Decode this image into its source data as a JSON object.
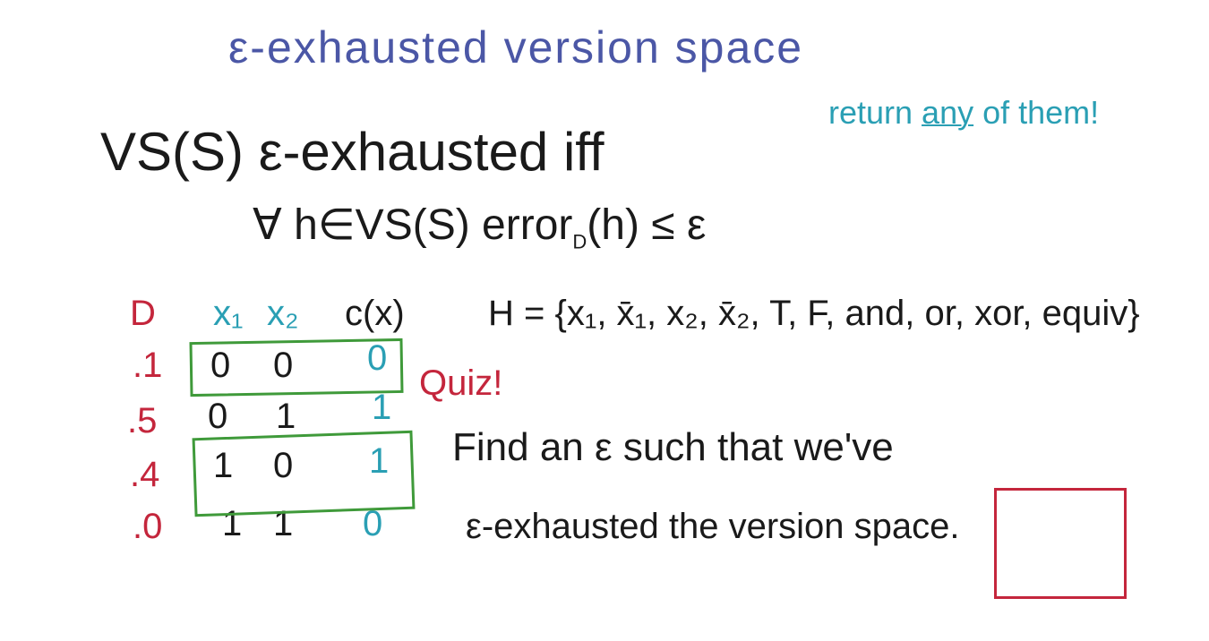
{
  "title": "ε-exhausted version space",
  "aside": {
    "prefix": "return ",
    "emph": "any",
    "suffix": " of them!"
  },
  "definition": "VS(S) ε-exhausted iff",
  "condition": {
    "pre": "∀ h∈VS(S)   error",
    "sub": "D",
    "post": "(h) ≤ ε"
  },
  "table": {
    "headers": {
      "d": "D",
      "x1": "x₁",
      "x2": "x₂",
      "c": "c(x)"
    },
    "rows": [
      {
        "d": ".1",
        "x1": "0",
        "x2": "0",
        "c": "0"
      },
      {
        "d": ".5",
        "x1": "0",
        "x2": "1",
        "c": "1"
      },
      {
        "d": ".4",
        "x1": "1",
        "x2": "0",
        "c": "1"
      },
      {
        "d": ".0",
        "x1": "1",
        "x2": "1",
        "c": "0"
      }
    ]
  },
  "hypothesis_set": "H = {x₁, x̄₁, x₂, x̄₂, T, F, and, or, xor, equiv}",
  "quiz_label": "Quiz!",
  "prompt_line1": "Find an ε such that we've",
  "prompt_line2": "ε-exhausted the version space."
}
